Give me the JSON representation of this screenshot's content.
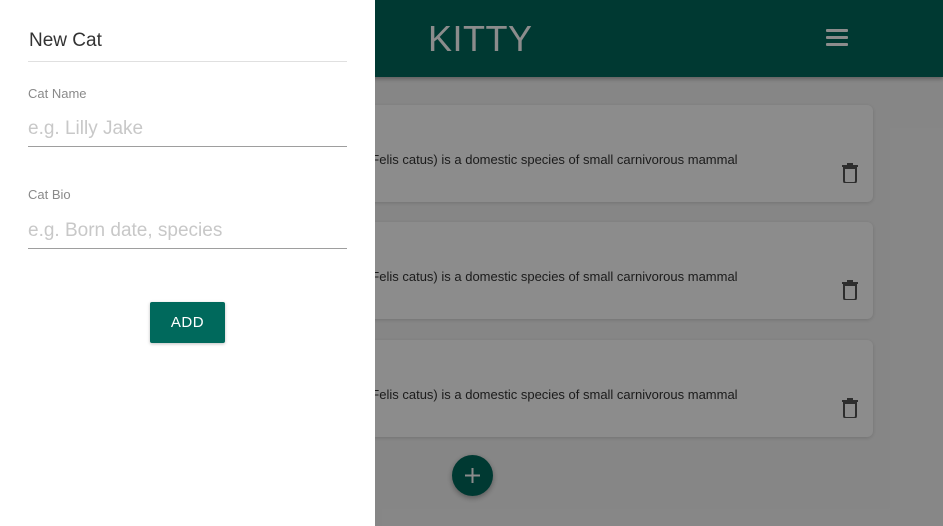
{
  "app": {
    "title": "KITTY",
    "menu_icon": "hamburger-menu-icon",
    "brand_color": "#00695c"
  },
  "cards": [
    {
      "text": "The cat (Felis catus) is a domestic species of small carnivorous mammal",
      "icon": "trash-icon"
    },
    {
      "text": "The cat (Felis catus) is a domestic species of small carnivorous mammal",
      "icon": "trash-icon"
    },
    {
      "text": "The cat (Felis catus) is a domestic species of small carnivorous mammal",
      "icon": "trash-icon"
    }
  ],
  "fab": {
    "icon": "plus-icon"
  },
  "drawer": {
    "title": "New Cat",
    "fields": [
      {
        "label": "Cat Name",
        "value": "",
        "placeholder": "e.g. Lilly Jake"
      },
      {
        "label": "Cat Bio",
        "value": "",
        "placeholder": "e.g. Born date, species"
      }
    ],
    "submit_label": "ADD"
  }
}
